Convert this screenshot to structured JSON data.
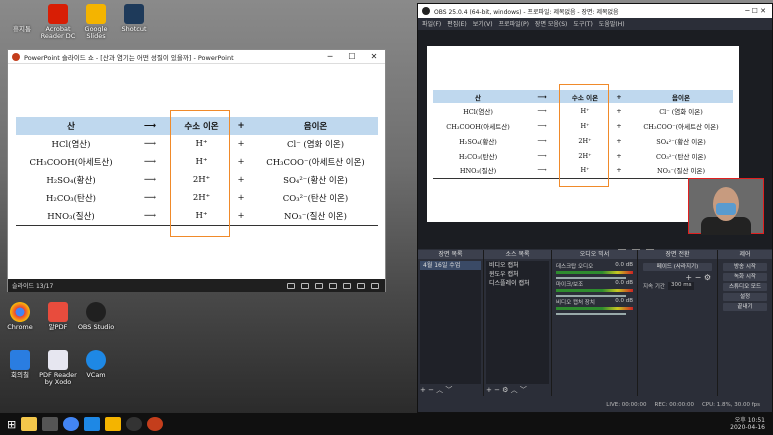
{
  "desktop": {
    "icons": [
      {
        "label": "휴지통",
        "color": "#8aa0b8"
      },
      {
        "label": "Acrobat Reader DC",
        "color": "#d81e05"
      },
      {
        "label": "Google Slides",
        "color": "#f4b400"
      },
      {
        "label": "Shotcut",
        "color": "#1e3a5a"
      },
      {
        "label": "Chrome",
        "color": "#4285f4"
      },
      {
        "label": "알PDF",
        "color": "#e84c3d"
      },
      {
        "label": "OBS Studio",
        "color": "#202020"
      },
      {
        "label": "회의칠",
        "color": "#2a7de1"
      },
      {
        "label": "PDF Reader by Xodo",
        "color": "#e6e6f0"
      },
      {
        "label": "VCam",
        "color": "#1e88e5"
      }
    ]
  },
  "ppt": {
    "title": "PowerPoint 슬라이드 쇼 - [산과 염기는 어떤 성질이 있을까] - PowerPoint",
    "slide_counter": "슬라이드 13/17",
    "headers": [
      "산",
      "",
      "수소 이온",
      "+",
      "음이온"
    ],
    "rows": [
      [
        "HCl(염산)",
        "⟶",
        "H⁺",
        "+",
        "Cl⁻ (염화 이온)"
      ],
      [
        "CH₃COOH(아세트산)",
        "⟶",
        "H⁺",
        "+",
        "CH₃COO⁻(아세트산 이온)"
      ],
      [
        "H₂SO₄(황산)",
        "⟶",
        "2H⁺",
        "+",
        "SO₄²⁻(황산 이온)"
      ],
      [
        "H₂CO₃(탄산)",
        "⟶",
        "2H⁺",
        "+",
        "CO₃²⁻(탄산 이온)"
      ],
      [
        "HNO₃(질산)",
        "⟶",
        "H⁺",
        "+",
        "NO₃⁻(질산 이온)"
      ]
    ]
  },
  "obs": {
    "title": "OBS 25.0.4 (64-bit, windows) - 프로파일: 제목없음 - 장면: 제목없음",
    "menu": [
      "파일(F)",
      "편집(E)",
      "보기(V)",
      "프로파일(P)",
      "장면 모음(S)",
      "도구(T)",
      "도움말(H)"
    ],
    "docks": {
      "scenes": {
        "title": "장면 목록",
        "items": [
          "4월 16일 수업"
        ]
      },
      "sources": {
        "title": "소스 목록",
        "items": [
          "비디오 캡처",
          "윈도우 캡처",
          "디스플레이 캡처"
        ]
      },
      "mixer": {
        "title": "오디오 믹서",
        "channels": [
          {
            "name": "데스크탑 오디오",
            "db": "0.0 dB"
          },
          {
            "name": "마이크/보조",
            "db": "0.0 dB"
          },
          {
            "name": "비디오 캡처 장치",
            "db": "0.0 dB"
          }
        ]
      },
      "transitions": {
        "title": "장면 전환",
        "type": "페이드 (사라지기)",
        "duration_label": "지속 기간",
        "duration": "300 ms"
      },
      "controls": {
        "title": "제어",
        "buttons": [
          "방송 시작",
          "녹화 시작",
          "스튜디오 모드",
          "설정",
          "끝내기"
        ]
      }
    },
    "status": {
      "live": "LIVE: 00:00:00",
      "rec": "REC: 00:00:00",
      "cpu": "CPU: 1.8%, 30.00 fps"
    }
  },
  "taskbar": {
    "time": "오후 10:51",
    "date": "2020-04-16"
  }
}
